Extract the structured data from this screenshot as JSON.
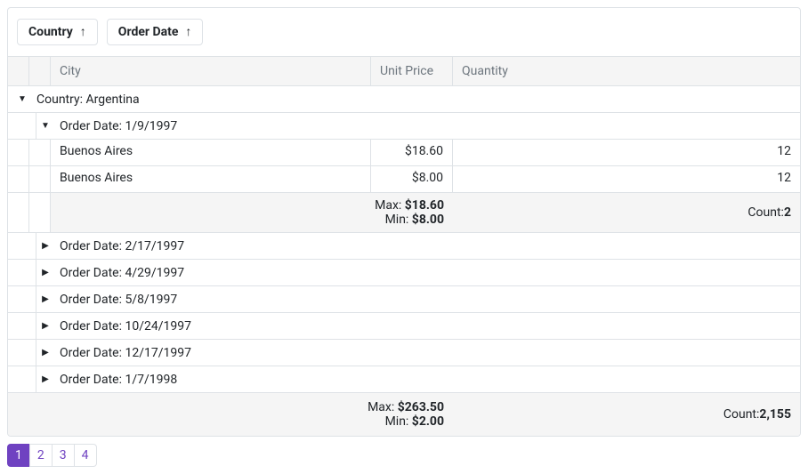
{
  "groupPanel": {
    "chips": [
      {
        "label": "Country",
        "sort": "↑"
      },
      {
        "label": "Order Date",
        "sort": "↑"
      }
    ]
  },
  "columns": {
    "city": "City",
    "unitPrice": "Unit Price",
    "quantity": "Quantity"
  },
  "countryGroup": {
    "text": "Country: Argentina"
  },
  "dateGroups": {
    "expanded": {
      "text": "Order Date: 1/9/1997",
      "rows": [
        {
          "city": "Buenos Aires",
          "price": "$18.60",
          "qty": "12"
        },
        {
          "city": "Buenos Aires",
          "price": "$8.00",
          "qty": "12"
        }
      ],
      "summary": {
        "maxLabel": "Max: ",
        "maxVal": "$18.60",
        "minLabel": "Min: ",
        "minVal": "$8.00",
        "countLabel": "Count: ",
        "countVal": "2"
      }
    },
    "collapsed": [
      {
        "text": "Order Date: 2/17/1997"
      },
      {
        "text": "Order Date: 4/29/1997"
      },
      {
        "text": "Order Date: 5/8/1997"
      },
      {
        "text": "Order Date: 10/24/1997"
      },
      {
        "text": "Order Date: 12/17/1997"
      },
      {
        "text": "Order Date: 1/7/1998"
      }
    ]
  },
  "footer": {
    "maxLabel": "Max: ",
    "maxVal": "$263.50",
    "minLabel": "Min: ",
    "minVal": "$2.00",
    "countLabel": "Count: ",
    "countVal": "2,155"
  },
  "pager": {
    "pages": [
      "1",
      "2",
      "3",
      "4"
    ],
    "active": "1"
  },
  "carets": {
    "expanded": "▼",
    "collapsed": "▶"
  }
}
